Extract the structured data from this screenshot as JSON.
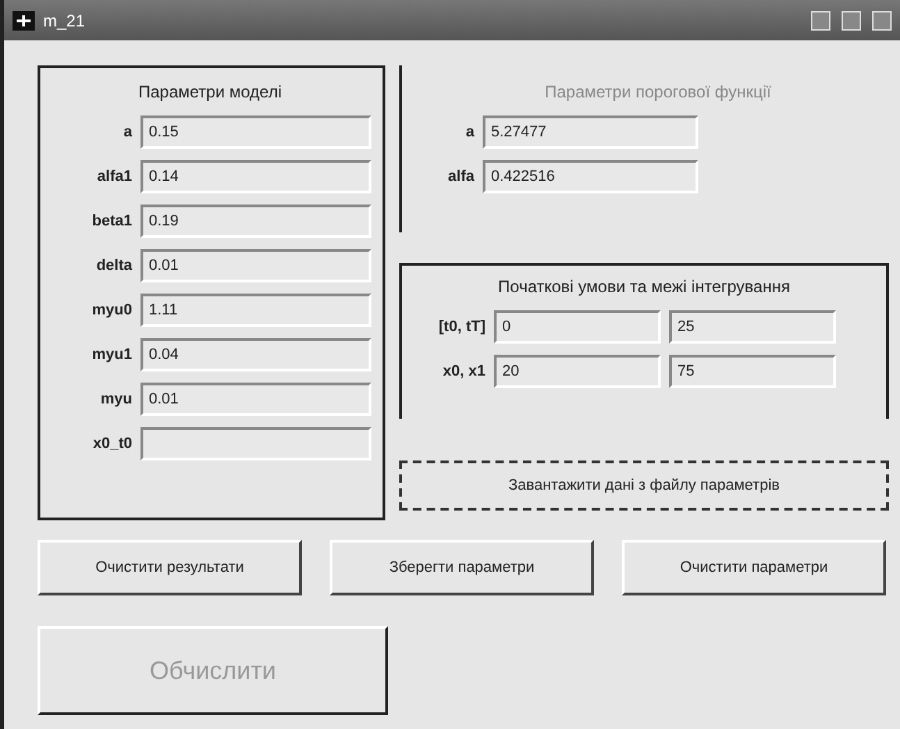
{
  "window": {
    "title": "m_21"
  },
  "model_params": {
    "title": "Параметри моделі",
    "fields": [
      {
        "label": "a",
        "value": "0.15"
      },
      {
        "label": "alfa1",
        "value": "0.14"
      },
      {
        "label": "beta1",
        "value": "0.19"
      },
      {
        "label": "delta",
        "value": "0.01"
      },
      {
        "label": "myu0",
        "value": "1.11"
      },
      {
        "label": "myu1",
        "value": "0.04"
      },
      {
        "label": "myu",
        "value": "0.01"
      },
      {
        "label": "x0_t0"
      }
    ]
  },
  "threshold_params": {
    "title": "Параметри порогової функції",
    "disabled": true,
    "fields": [
      {
        "label": "a",
        "value": "5.27477"
      },
      {
        "label": "alfa",
        "value": "0.422516"
      }
    ]
  },
  "integration": {
    "title": "Початкові умови та межі інтегрування",
    "rows": [
      {
        "label": "[t0, tT]",
        "from": "0",
        "to": "25"
      },
      {
        "label": "x0, x1",
        "from": "20",
        "to": "75"
      }
    ]
  },
  "focus_button": {
    "label": "Завантажити дані з файлу параметрів",
    "focused": true
  },
  "buttons": [
    {
      "label": "Очистити результати",
      "disabled": false
    },
    {
      "label": "Зберегти параметри",
      "disabled": false
    },
    {
      "label": "Очистити параметри",
      "disabled": false
    }
  ],
  "compute_button": {
    "label": "Обчислити",
    "disabled": true
  }
}
